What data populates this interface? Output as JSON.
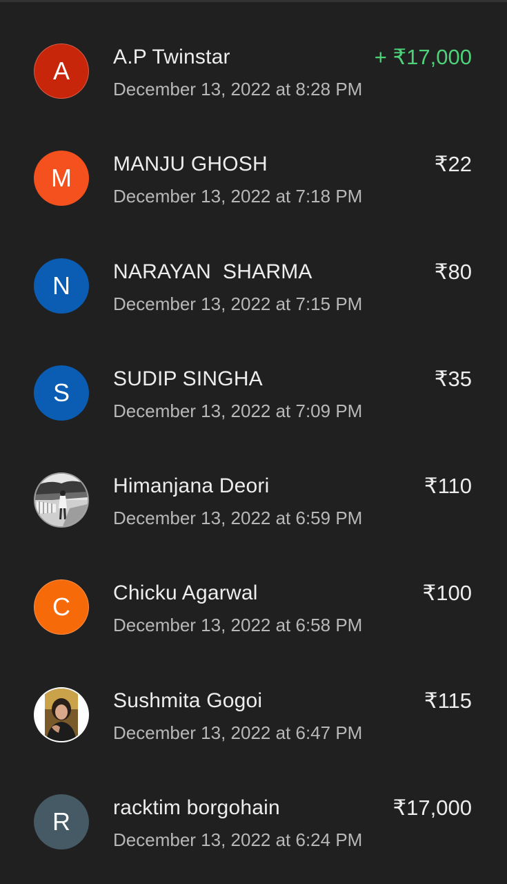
{
  "colors": {
    "background": "#202020",
    "credit_green": "#4fd17a"
  },
  "transactions": [
    {
      "initial": "A",
      "name": "A.P Twinstar",
      "time": "December 13, 2022 at 8:28 PM",
      "amount": "+ ₹17,000",
      "avatar_color": "#c8260a",
      "credit": true
    },
    {
      "initial": "M",
      "name": "MANJU GHOSH",
      "time": "December 13, 2022 at 7:18 PM",
      "amount": "₹22",
      "avatar_color": "#f4511e"
    },
    {
      "initial": "N",
      "name": "NARAYAN  SHARMA",
      "time": "December 13, 2022 at 7:15 PM",
      "amount": "₹80",
      "avatar_color": "#0a5db3"
    },
    {
      "initial": "S",
      "name": "SUDIP SINGHA",
      "time": "December 13, 2022 at 7:09 PM",
      "amount": "₹35",
      "avatar_color": "#0a5db3"
    },
    {
      "initial": "",
      "name": "Himanjana Deori",
      "time": "December 13, 2022 at 6:59 PM",
      "amount": "₹110",
      "avatar_icon": "photo-avatar-icon"
    },
    {
      "initial": "C",
      "name": "Chicku Agarwal",
      "time": "December 13, 2022 at 6:58 PM",
      "amount": "₹100",
      "avatar_color": "#f66a0a"
    },
    {
      "initial": "",
      "name": "Sushmita Gogoi",
      "time": "December 13, 2022 at 6:47 PM",
      "amount": "₹115",
      "avatar_icon": "photo-avatar-icon"
    },
    {
      "initial": "R",
      "name": "racktim borgohain",
      "time": "December 13, 2022 at 6:24 PM",
      "amount": "₹17,000",
      "avatar_color": "#455a64"
    }
  ]
}
